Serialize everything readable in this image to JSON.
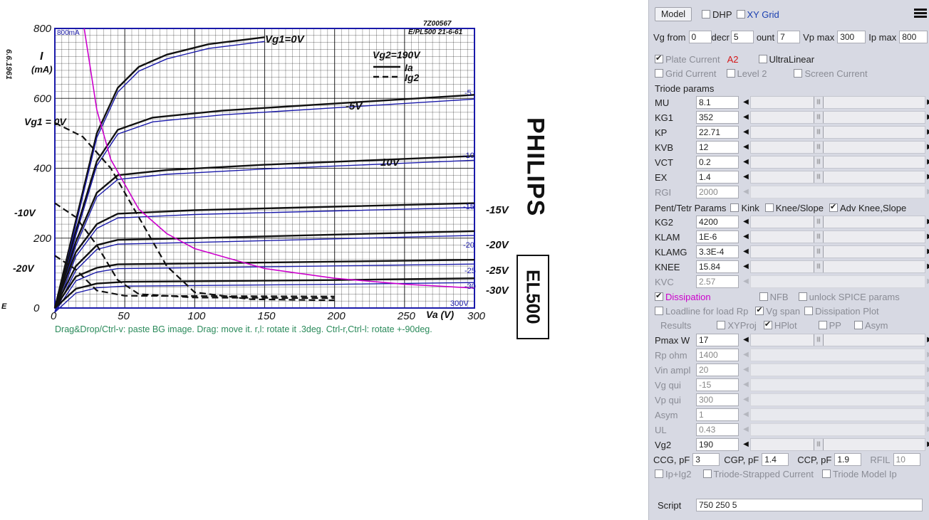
{
  "hint_text": "Drag&Drop/Ctrl-v: paste BG image. Drag: move it. r,l: rotate it .3deg. Ctrl-r,Ctrl-l: rotate +-90deg.",
  "datasheet": {
    "doc_id": "7Z00567",
    "doc_ref": "E/PL500  21-6-61",
    "scale_label": "800mA",
    "date": "6.6.1961",
    "brand": "PHILIPS",
    "tube": "EL500",
    "ylabel": "I",
    "yunit": "(mA)",
    "xlabel": "Va (V)",
    "vg2_label": "Vg2=190V",
    "ia_label": "Ia",
    "ig2_label": "Ig2",
    "vg1_top": "Vg1=0V",
    "vg1_left": "Vg1 = 0V",
    "left_markers": [
      "-10V",
      "-20V"
    ],
    "curve_labels": [
      "-5V",
      "10V",
      "-15V",
      "-20V",
      "-25V",
      "-30V"
    ],
    "right_numbers": [
      "-5",
      "-10",
      "-15",
      "-20",
      "-25",
      "-30"
    ],
    "label_300v": "300V",
    "corner": "E"
  },
  "chart_data": {
    "type": "line",
    "xlabel": "Va (V)",
    "ylabel": "I (mA)",
    "xlim": [
      0,
      300
    ],
    "ylim": [
      0,
      800
    ],
    "xticks": [
      0,
      50,
      100,
      150,
      200,
      250,
      300
    ],
    "yticks": [
      0,
      200,
      400,
      600,
      800
    ],
    "series": [
      {
        "name": "Vg1=0V",
        "points": [
          [
            0,
            0
          ],
          [
            15,
            250
          ],
          [
            30,
            500
          ],
          [
            45,
            630
          ],
          [
            60,
            690
          ],
          [
            80,
            725
          ],
          [
            110,
            755
          ],
          [
            150,
            775
          ]
        ]
      },
      {
        "name": "-5V",
        "points": [
          [
            0,
            0
          ],
          [
            15,
            220
          ],
          [
            30,
            420
          ],
          [
            45,
            510
          ],
          [
            70,
            545
          ],
          [
            120,
            565
          ],
          [
            200,
            585
          ],
          [
            300,
            610
          ]
        ]
      },
      {
        "name": "-10V",
        "points": [
          [
            0,
            0
          ],
          [
            15,
            190
          ],
          [
            30,
            330
          ],
          [
            45,
            380
          ],
          [
            80,
            395
          ],
          [
            150,
            410
          ],
          [
            240,
            425
          ],
          [
            300,
            435
          ]
        ]
      },
      {
        "name": "-15V",
        "points": [
          [
            0,
            0
          ],
          [
            15,
            160
          ],
          [
            30,
            240
          ],
          [
            45,
            270
          ],
          [
            100,
            280
          ],
          [
            200,
            290
          ],
          [
            300,
            300
          ]
        ]
      },
      {
        "name": "-20V",
        "points": [
          [
            0,
            0
          ],
          [
            15,
            120
          ],
          [
            30,
            180
          ],
          [
            45,
            195
          ],
          [
            100,
            200
          ],
          [
            200,
            210
          ],
          [
            300,
            220
          ]
        ]
      },
      {
        "name": "-25V",
        "points": [
          [
            0,
            0
          ],
          [
            15,
            90
          ],
          [
            30,
            115
          ],
          [
            45,
            125
          ],
          [
            150,
            130
          ],
          [
            300,
            138
          ]
        ]
      },
      {
        "name": "-30V",
        "points": [
          [
            0,
            0
          ],
          [
            15,
            55
          ],
          [
            30,
            70
          ],
          [
            50,
            75
          ],
          [
            200,
            80
          ],
          [
            300,
            85
          ]
        ]
      },
      {
        "name": "Pmax 17W",
        "points": [
          [
            21,
            800
          ],
          [
            30,
            567
          ],
          [
            40,
            425
          ],
          [
            60,
            283
          ],
          [
            80,
            213
          ],
          [
            100,
            170
          ],
          [
            150,
            113
          ],
          [
            200,
            85
          ],
          [
            250,
            68
          ],
          [
            300,
            57
          ]
        ]
      }
    ],
    "grid": true
  },
  "panel": {
    "model_btn": "Model",
    "dhp": "DHP",
    "xy_grid": "XY Grid",
    "vg_from_label": "Vg from",
    "vg_from": "0",
    "decr_label": "decr",
    "decr": "5",
    "count_label": "ount",
    "count": "7",
    "vpmax_label": "Vp max",
    "vpmax": "300",
    "ipmax_label": "Ip max",
    "ipmax": "800",
    "plate_current": "Plate Current",
    "a2": "A2",
    "ultralinear": "UltraLinear",
    "grid_current": "Grid Current",
    "level2": "Level 2",
    "screen_current": "Screen Current",
    "triode_params": "Triode params",
    "triode_rows": [
      {
        "label": "MU",
        "value": "8.1"
      },
      {
        "label": "KG1",
        "value": "352"
      },
      {
        "label": "KP",
        "value": "22.71"
      },
      {
        "label": "KVB",
        "value": "12"
      },
      {
        "label": "VCT",
        "value": "0.2"
      },
      {
        "label": "EX",
        "value": "1.4"
      },
      {
        "label": "RGI",
        "value": "2000"
      }
    ],
    "pent_params": "Pent/Tetr Params",
    "kink": "Kink",
    "knee_slope": "Knee/Slope",
    "adv_knee": "Adv Knee,Slope",
    "pent_rows": [
      {
        "label": "KG2",
        "value": "4200"
      },
      {
        "label": "KLAM",
        "value": "1E-6"
      },
      {
        "label": "KLAMG",
        "value": "3.3E-4"
      },
      {
        "label": "KNEE",
        "value": "15.84"
      },
      {
        "label": "KVC",
        "value": "2.57"
      }
    ],
    "dissipation": "Dissipation",
    "nfb": "NFB",
    "unlock_spice": "unlock SPICE params",
    "loadline": "Loadline for load Rp",
    "vg_span": "Vg span",
    "dissipation_plot": "Dissipation Plot",
    "results": "Results",
    "xyproj": "XYProj",
    "hplot": "HPlot",
    "pp": "PP",
    "asym_cb": "Asym",
    "op_rows": [
      {
        "label": "Pmax W",
        "value": "17"
      },
      {
        "label": "Rp ohm",
        "value": "1400"
      },
      {
        "label": "Vin ampl",
        "value": "20"
      },
      {
        "label": "Vg qui",
        "value": "-15"
      },
      {
        "label": "Vp qui",
        "value": "300"
      },
      {
        "label": "Asym",
        "value": "1"
      },
      {
        "label": "UL",
        "value": "0.43"
      },
      {
        "label": "Vg2",
        "value": "190"
      }
    ],
    "ccg_label": "CCG, pF",
    "ccg": "3",
    "cgp_label": "CGP, pF",
    "cgp": "1.4",
    "ccp_label": "CCP, pF",
    "ccp": "1.9",
    "rfil_label": "RFIL",
    "rfil": "10",
    "ip_ig2": "Ip+Ig2",
    "triode_strapped": "Triode-Strapped Current",
    "triode_model_ip": "Triode Model Ip",
    "script_label": "Script",
    "script_value": "750 250 5"
  },
  "colors": {
    "plate_current": "#d41818",
    "dissipation": "#cc00cc",
    "grid_blue": "#1a1aaa",
    "hint": "#2a8a5a"
  }
}
